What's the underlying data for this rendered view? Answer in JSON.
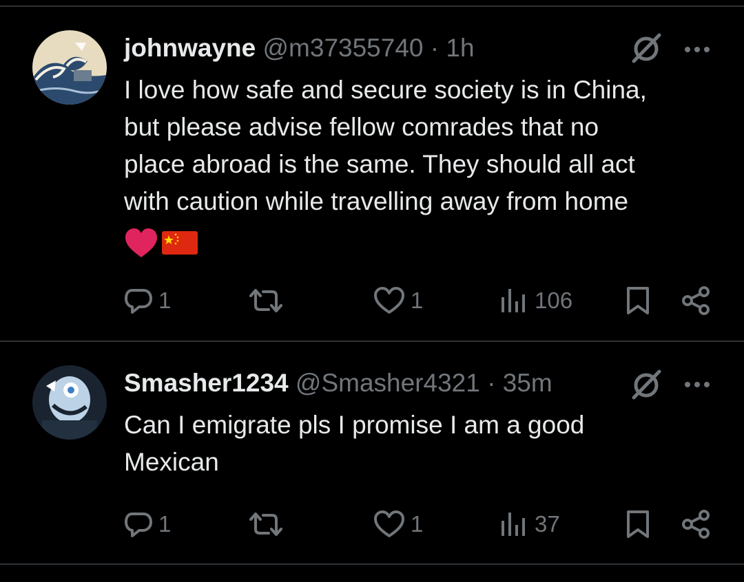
{
  "colors": {
    "background": "#000000",
    "text_primary": "#e7e9ea",
    "text_secondary": "#71767b",
    "divider": "#2f3336",
    "heart_emoji": "#e0245e",
    "china_flag_red": "#de2910",
    "china_flag_star": "#ffde00"
  },
  "tweets": [
    {
      "display_name": "johnwayne",
      "handle": "@m37355740",
      "separator": "·",
      "time": "1h",
      "text_lines": [
        "I love how safe and secure society is in China,",
        "but please advise fellow comrades that no",
        "place abroad is the same. They should all act",
        "with caution while travelling away from home"
      ],
      "emojis": [
        "red-heart",
        "flag-china"
      ],
      "replies": "1",
      "retweets": "",
      "likes": "1",
      "views": "106"
    },
    {
      "display_name": "Smasher1234",
      "handle": "@Smasher4321",
      "separator": "·",
      "time": "35m",
      "text_lines": [
        "Can I emigrate pls I promise I am a good",
        "Mexican"
      ],
      "emojis": [],
      "replies": "1",
      "retweets": "",
      "likes": "1",
      "views": "37"
    }
  ],
  "icons": {
    "reply": "reply-icon",
    "retweet": "retweet-icon",
    "like": "heart-icon",
    "views": "views-icon",
    "bookmark": "bookmark-icon",
    "share": "share-icon",
    "grok": "grok-icon",
    "more": "more-icon"
  }
}
